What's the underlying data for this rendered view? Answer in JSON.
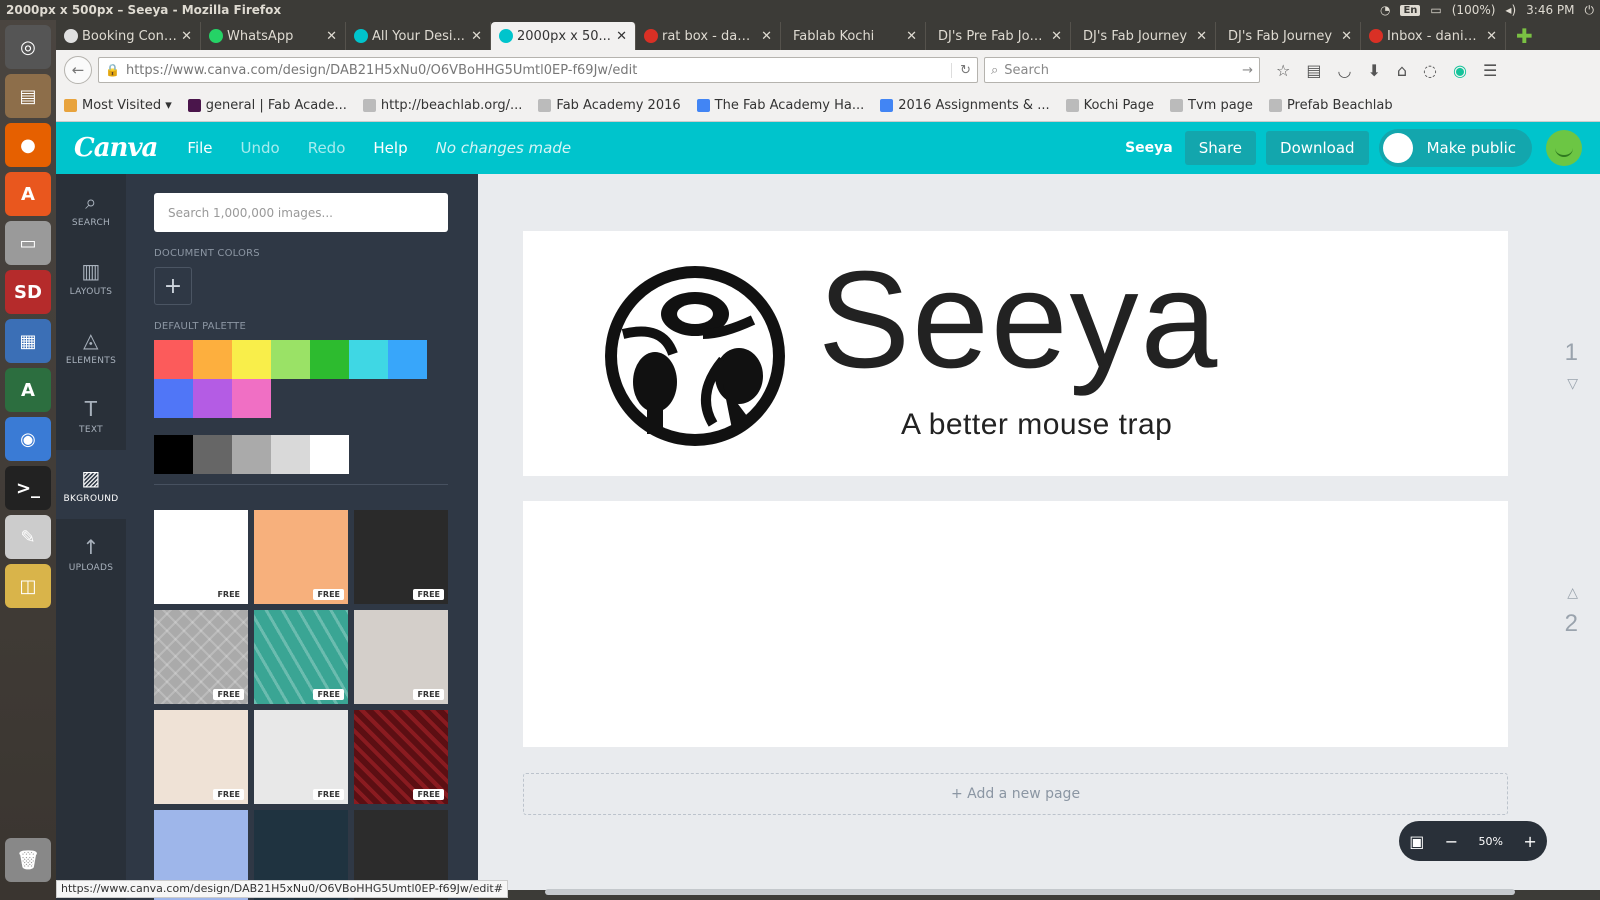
{
  "os": {
    "window_title": "2000px x 500px – Seeya - Mozilla Firefox",
    "lang": "En",
    "battery": "(100%)",
    "time": "3:46 PM"
  },
  "tabs": [
    {
      "label": "Booking Confirm...",
      "color": "#e0e0e0",
      "active": false
    },
    {
      "label": "WhatsApp",
      "color": "#25d366",
      "active": false
    },
    {
      "label": "All Your Desi...",
      "color": "#00c4cc",
      "active": false
    },
    {
      "label": "2000px x 50...",
      "color": "#00c4cc",
      "active": true
    },
    {
      "label": "rat box - dan...",
      "color": "#d93025",
      "active": false
    },
    {
      "label": "Fablab Kochi",
      "color": "",
      "active": false
    },
    {
      "label": "DJ's Pre Fab Jou...",
      "color": "",
      "active": false
    },
    {
      "label": "DJ's Fab Journey",
      "color": "",
      "active": false
    },
    {
      "label": "DJ's Fab Journey",
      "color": "",
      "active": false
    },
    {
      "label": "Inbox - danie...",
      "color": "#d93025",
      "active": false
    }
  ],
  "nav": {
    "url": "https://www.canva.com/design/DAB21H5xNu0/O6VBoHHG5Umtl0EP-f69Jw/edit",
    "search_placeholder": "Search"
  },
  "bookmarks": [
    {
      "label": "Most Visited ▾",
      "color": "#e8a33d"
    },
    {
      "label": "general | Fab Acade...",
      "color": "#4a154b"
    },
    {
      "label": "http://beachlab.org/...",
      "color": "#bbbbbb"
    },
    {
      "label": "Fab Academy 2016",
      "color": "#bbbbbb"
    },
    {
      "label": "The Fab Academy Ha...",
      "color": "#4285f4"
    },
    {
      "label": "2016 Assignments & ...",
      "color": "#4285f4"
    },
    {
      "label": "Kochi Page",
      "color": "#bbbbbb"
    },
    {
      "label": "Tvm page",
      "color": "#bbbbbb"
    },
    {
      "label": "Prefab Beachlab",
      "color": "#bbbbbb"
    }
  ],
  "canva": {
    "logo": "Canva",
    "menu": {
      "file": "File",
      "undo": "Undo",
      "redo": "Redo",
      "help": "Help"
    },
    "status": "No changes made",
    "design_name": "Seeya",
    "share": "Share",
    "download": "Download",
    "make_public": "Make public"
  },
  "rail": [
    {
      "label": "SEARCH",
      "icon": "search-icon",
      "glyph": "⌕"
    },
    {
      "label": "LAYOUTS",
      "icon": "layouts-icon",
      "glyph": "▥"
    },
    {
      "label": "ELEMENTS",
      "icon": "elements-icon",
      "glyph": "◬"
    },
    {
      "label": "TEXT",
      "icon": "text-icon",
      "glyph": "T"
    },
    {
      "label": "BKGROUND",
      "icon": "background-icon",
      "glyph": "▨"
    },
    {
      "label": "UPLOADS",
      "icon": "upload-icon",
      "glyph": "↑"
    }
  ],
  "panel": {
    "search_placeholder": "Search 1,000,000 images...",
    "doc_colors_label": "DOCUMENT COLORS",
    "default_palette_label": "DEFAULT PALETTE",
    "palette": [
      "#fc5b5b",
      "#fdaf3e",
      "#f9ee4a",
      "#9ae266",
      "#2dbb2f",
      "#3fd7e4",
      "#38a6fa",
      "#5076f7",
      "#b45ce4",
      "#f06fc4"
    ],
    "grays": [
      "#000000",
      "#666666",
      "#aaaaaa",
      "#d9d9d9",
      "#ffffff"
    ],
    "free_label": "FREE",
    "backgrounds": [
      "#ffffff",
      "#f7b07c",
      "#2a2a2a",
      "#aaaaaa",
      "#3aa594",
      "#d4cfca",
      "#efe2d6",
      "#e8e8e8",
      "#5c0f13",
      "#9eb6ea",
      "#1f3340",
      "#2c2c2c"
    ]
  },
  "design": {
    "brand": "Seeya",
    "tagline": "A better mouse trap",
    "page1": "1",
    "page2": "2",
    "add_page": "+ Add a new page",
    "zoom": "50%"
  },
  "status_url": "https://www.canva.com/design/DAB21H5xNu0/O6VBoHHG5Umtl0EP-f69Jw/edit#"
}
